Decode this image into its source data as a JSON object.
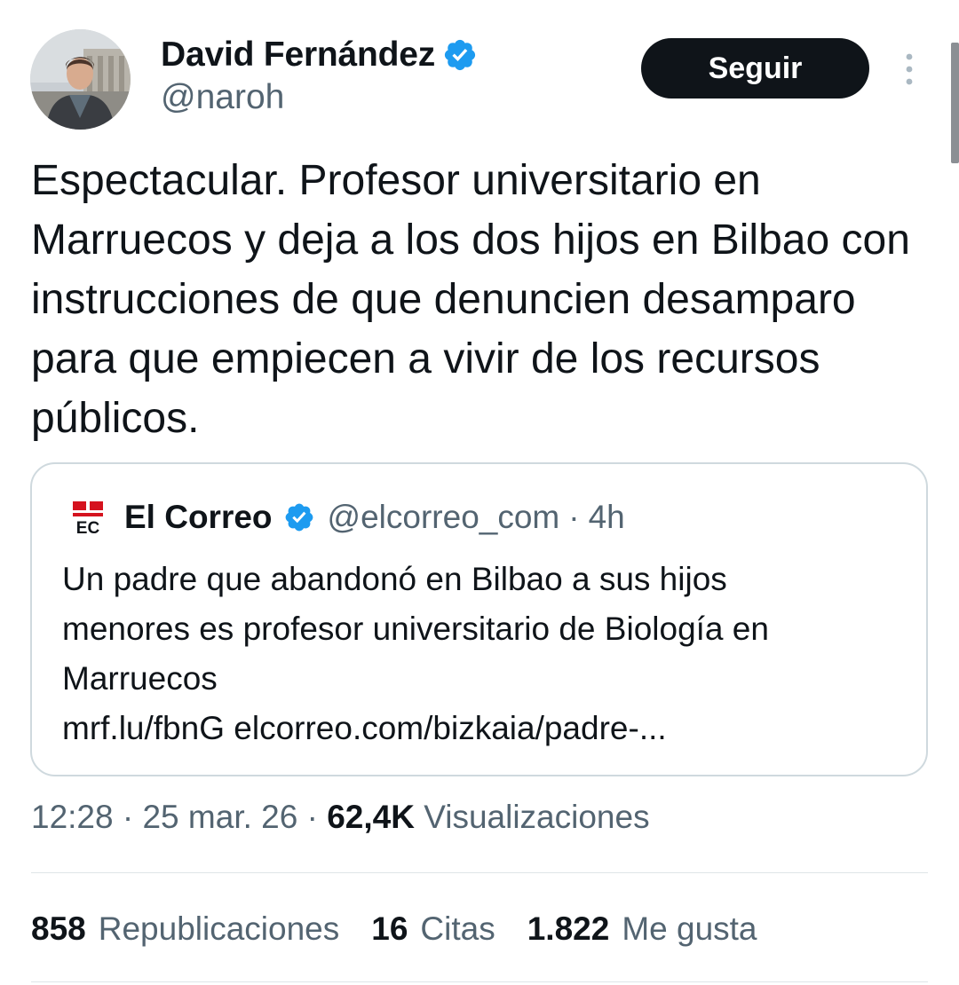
{
  "author": {
    "name": "David Fernández",
    "handle": "@naroh",
    "verified": true
  },
  "follow_button_label": "Seguir",
  "tweet_text": "Espectacular. Profesor universitario en Marruecos y deja a los dos hijos en Bilbao con instrucciones de que denuncien desamparo para que empiecen a vivir de los recursos públicos.",
  "quoted_tweet": {
    "logo_text": "EC",
    "name": "El Correo",
    "handle": "@elcorreo_com",
    "separator": "·",
    "time": "4h",
    "text_lines": [
      "Un padre que abandonó en Bilbao a sus hijos",
      "menores es profesor universitario de Biología en",
      "Marruecos",
      "mrf.lu/fbnG elcorreo.com/bizkaia/padre-..."
    ]
  },
  "meta": {
    "time": "12:28",
    "separator": "·",
    "date": "25 mar. 26",
    "views_count": "62,4K",
    "views_label": "Visualizaciones"
  },
  "stats": [
    {
      "value": "858",
      "label": "Republicaciones"
    },
    {
      "value": "16",
      "label": "Citas"
    },
    {
      "value": "1.822",
      "label": "Me gusta"
    }
  ],
  "icons": {
    "verified": "verified-badge-icon",
    "more": "more-options-icon"
  },
  "colors": {
    "text_primary": "#0f1419",
    "text_secondary": "#536471",
    "verified_blue": "#1d9bf0",
    "button_bg": "#0f1419",
    "border": "#cfd9de",
    "el_correo_red": "#d5121e"
  }
}
